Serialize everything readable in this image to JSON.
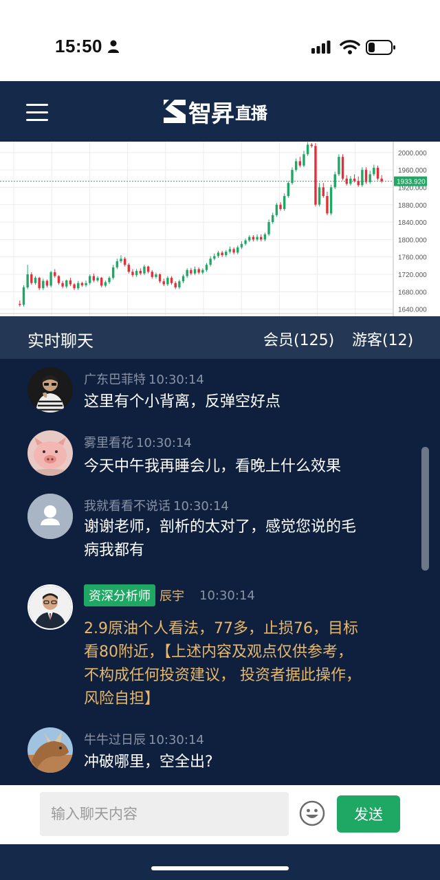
{
  "status_bar": {
    "time": "15:50"
  },
  "header": {
    "logo_big": "智昇",
    "logo_small": "直播"
  },
  "chart_data": {
    "type": "candlestick",
    "price_label": "1933.920",
    "ylim": [
      1630,
      2025
    ],
    "yticks": [
      1640,
      1680,
      1720,
      1760,
      1800,
      1840,
      1880,
      1920,
      1960,
      2000
    ],
    "up_color": "#1fa864",
    "down_color": "#e0313b",
    "candles": [
      [
        1652,
        1650,
        1660
      ],
      [
        1650,
        1690,
        1695
      ],
      [
        1690,
        1720,
        1742
      ],
      [
        1720,
        1700,
        1725
      ],
      [
        1700,
        1712,
        1716
      ],
      [
        1712,
        1688,
        1714
      ],
      [
        1688,
        1705,
        1710
      ],
      [
        1705,
        1694,
        1708
      ],
      [
        1694,
        1725,
        1728
      ],
      [
        1725,
        1716,
        1732
      ],
      [
        1716,
        1700,
        1718
      ],
      [
        1700,
        1692,
        1705
      ],
      [
        1692,
        1706,
        1708
      ],
      [
        1706,
        1697,
        1712
      ],
      [
        1697,
        1688,
        1700
      ],
      [
        1688,
        1700,
        1705
      ],
      [
        1700,
        1695,
        1703
      ],
      [
        1695,
        1700,
        1706
      ],
      [
        1700,
        1716,
        1720
      ],
      [
        1716,
        1706,
        1722
      ],
      [
        1706,
        1712,
        1716
      ],
      [
        1712,
        1694,
        1714
      ],
      [
        1694,
        1702,
        1706
      ],
      [
        1702,
        1712,
        1716
      ],
      [
        1712,
        1736,
        1742
      ],
      [
        1736,
        1750,
        1756
      ],
      [
        1750,
        1756,
        1764
      ],
      [
        1756,
        1742,
        1760
      ],
      [
        1742,
        1726,
        1746
      ],
      [
        1726,
        1718,
        1732
      ],
      [
        1718,
        1728,
        1732
      ],
      [
        1728,
        1722,
        1734
      ],
      [
        1722,
        1738,
        1742
      ],
      [
        1738,
        1726,
        1740
      ],
      [
        1726,
        1714,
        1730
      ],
      [
        1714,
        1720,
        1724
      ],
      [
        1720,
        1704,
        1722
      ],
      [
        1704,
        1697,
        1710
      ],
      [
        1697,
        1712,
        1716
      ],
      [
        1712,
        1700,
        1716
      ],
      [
        1700,
        1690,
        1704
      ],
      [
        1690,
        1704,
        1708
      ],
      [
        1704,
        1716,
        1720
      ],
      [
        1716,
        1730,
        1734
      ],
      [
        1730,
        1722,
        1735
      ],
      [
        1722,
        1732,
        1738
      ],
      [
        1732,
        1724,
        1736
      ],
      [
        1724,
        1730,
        1734
      ],
      [
        1730,
        1742,
        1746
      ],
      [
        1742,
        1756,
        1762
      ],
      [
        1756,
        1762,
        1768
      ],
      [
        1762,
        1770,
        1774
      ],
      [
        1770,
        1764,
        1774
      ],
      [
        1764,
        1772,
        1776
      ],
      [
        1772,
        1778,
        1784
      ],
      [
        1778,
        1770,
        1782
      ],
      [
        1770,
        1782,
        1786
      ],
      [
        1782,
        1790,
        1796
      ],
      [
        1790,
        1798,
        1802
      ],
      [
        1798,
        1806,
        1810
      ],
      [
        1806,
        1800,
        1810
      ],
      [
        1800,
        1806,
        1812
      ],
      [
        1806,
        1800,
        1812
      ],
      [
        1800,
        1812,
        1816
      ],
      [
        1812,
        1840,
        1846
      ],
      [
        1840,
        1856,
        1862
      ],
      [
        1856,
        1880,
        1884
      ],
      [
        1880,
        1870,
        1886
      ],
      [
        1870,
        1900,
        1906
      ],
      [
        1900,
        1930,
        1934
      ],
      [
        1930,
        1960,
        1966
      ],
      [
        1960,
        1980,
        1986
      ],
      [
        1980,
        1970,
        1990
      ],
      [
        1970,
        1996,
        2004
      ],
      [
        1996,
        2018,
        2024
      ],
      [
        2018,
        2015,
        2022
      ],
      [
        2015,
        1880,
        2022
      ],
      [
        1880,
        1920,
        1930
      ],
      [
        1920,
        1900,
        1930
      ],
      [
        1900,
        1860,
        1910
      ],
      [
        1860,
        1920,
        1926
      ],
      [
        1920,
        1950,
        1956
      ],
      [
        1950,
        1990,
        1996
      ],
      [
        1990,
        1940,
        1996
      ],
      [
        1940,
        1928,
        1948
      ],
      [
        1928,
        1940,
        1946
      ],
      [
        1940,
        1935,
        1950
      ],
      [
        1935,
        1925,
        1945
      ],
      [
        1925,
        1960,
        1966
      ],
      [
        1960,
        1932,
        1966
      ],
      [
        1932,
        1950,
        1958
      ],
      [
        1950,
        1965,
        1972
      ],
      [
        1965,
        1940,
        1970
      ],
      [
        1940,
        1934,
        1948
      ]
    ]
  },
  "chat": {
    "title": "实时聊天",
    "members": "会员(125)",
    "guests": "游客(12)",
    "messages": [
      {
        "user": "广东巴菲特",
        "time": "10:30:14",
        "text": "这里有个小背离，反弹空好点"
      },
      {
        "user": "雾里看花",
        "time": "10:30:14",
        "text": "今天中午我再睡会儿，看晚上什么效果"
      },
      {
        "user": "我就看看不说话",
        "time": "10:30:14",
        "text": "谢谢老师，剖析的太对了，感觉您说的毛病我都有"
      },
      {
        "badge": "资深分析师",
        "user": "辰宇",
        "time": "10:30:14",
        "text": "2.9原油个人看法，77多，止损76，目标看80附近，【上述内容及观点仅供参考，不构成任何投资建议， 投资者据此操作，风险自担】"
      },
      {
        "user": "牛牛过日辰",
        "time": "10:30:14",
        "text": "冲破哪里，空全出?"
      }
    ]
  },
  "input": {
    "placeholder": "输入聊天内容",
    "send_label": "发送"
  }
}
